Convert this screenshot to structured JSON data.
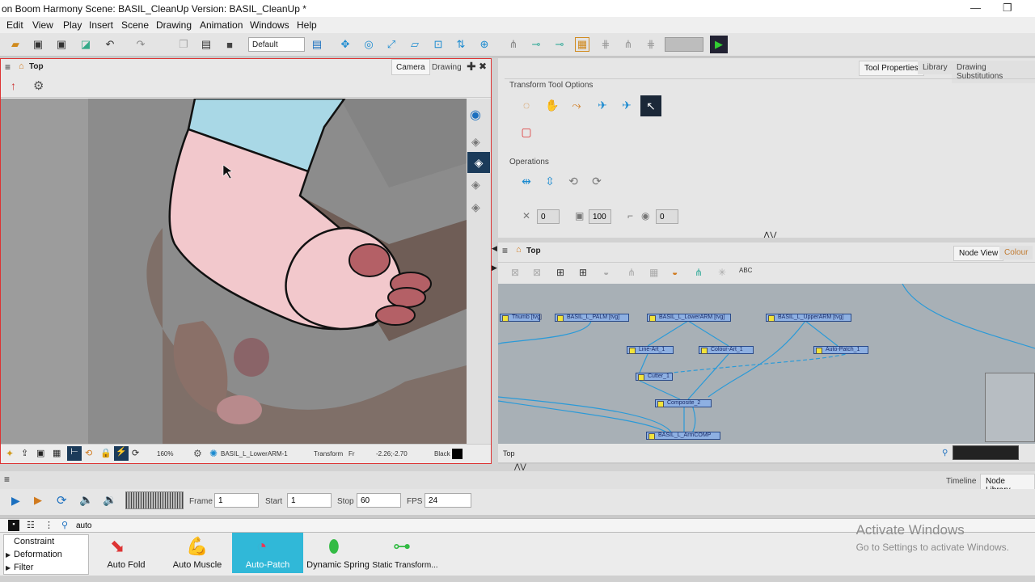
{
  "window": {
    "title": "on Boom Harmony Scene: BASIL_CleanUp Version: BASIL_CleanUp *",
    "minimize": "—",
    "restore": "❐"
  },
  "menu": [
    "Edit",
    "View",
    "Play",
    "Insert",
    "Scene",
    "Drawing",
    "Animation",
    "Windows",
    "Help"
  ],
  "toolbar": {
    "workspace": "Default"
  },
  "viewport": {
    "title": "Top",
    "tabs": [
      "Camera",
      "Drawing"
    ],
    "status": {
      "zoom": "160%",
      "layer": "BASIL_L_LowerARM-1",
      "tool": "Transform",
      "fr": "Fr",
      "coords": "-2.26;-2.70",
      "color": "Black"
    }
  },
  "tool_properties": {
    "tabs": [
      "Tool Properties",
      "Library",
      "Drawing Substitutions"
    ],
    "section1": "Transform Tool Options",
    "section2": "Operations",
    "fields": [
      "0",
      "100",
      "0"
    ]
  },
  "node_view": {
    "title": "Top",
    "tabs": [
      "Node View",
      "Colour"
    ],
    "footer": "Top",
    "nodes": [
      {
        "label": "Thumb [tvg]"
      },
      {
        "label": "BASIL_L_PALM [tvg]"
      },
      {
        "label": "BASIL_L_LowerARM [tvg]"
      },
      {
        "label": "BASIL_L_UpperARM [tvg]"
      },
      {
        "label": "Line-Art_1"
      },
      {
        "label": "Colour-Art_1"
      },
      {
        "label": "Auto-Patch_1"
      },
      {
        "label": "Cutter_1"
      },
      {
        "label": "Composite_2"
      },
      {
        "label": "BASIL_L_ArmCOMP"
      }
    ]
  },
  "timeline": {
    "tabs": [
      "Timeline",
      "Node Library"
    ],
    "frame_label": "Frame",
    "frame": "1",
    "start_label": "Start",
    "start": "1",
    "stop_label": "Stop",
    "stop": "60",
    "fps_label": "FPS",
    "fps": "24"
  },
  "library": {
    "search": "auto",
    "categories": [
      "Constraint",
      "Deformation",
      "Filter"
    ],
    "modules": [
      "Auto Fold",
      "Auto Muscle",
      "Auto-Patch",
      "Dynamic Spring",
      "Static Transform..."
    ]
  },
  "watermark": {
    "line1": "Activate Windows",
    "line2": "Go to Settings to activate Windows."
  },
  "colors": {
    "accent": "#30b8d8",
    "skin": "#f2c8cc",
    "sleeve": "#a9d8e6",
    "nail": "#b46066",
    "node_fill": "#8eb0e2"
  },
  "icons": [
    "home-icon",
    "eye-icon",
    "layers-icon",
    "gear-icon",
    "play-icon",
    "loop-icon",
    "sound-icon",
    "search-icon"
  ]
}
